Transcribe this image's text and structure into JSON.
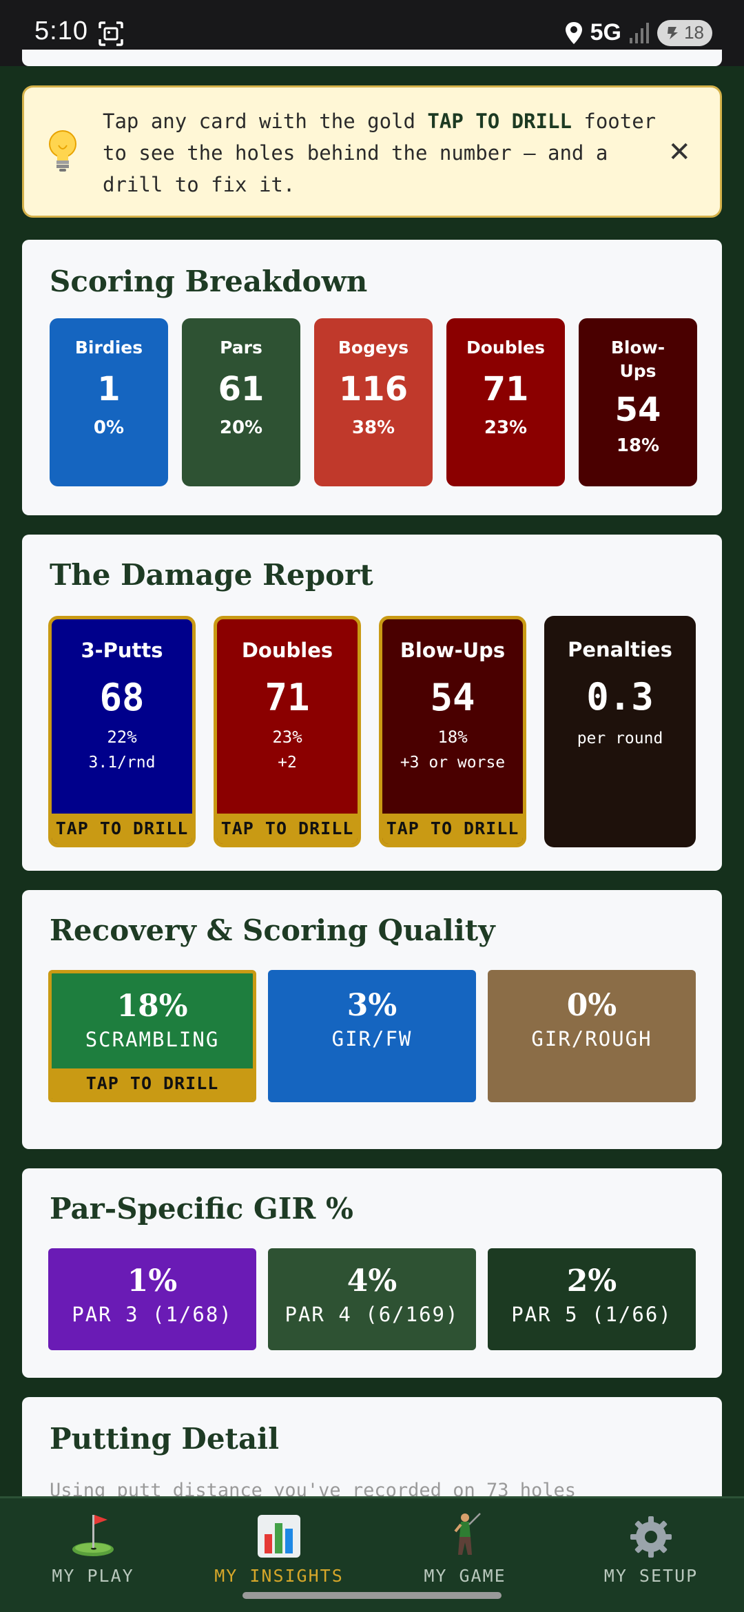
{
  "status_bar": {
    "time": "5:10",
    "network": "5G",
    "battery": "18"
  },
  "tip": {
    "text_before": "Tap any card with the gold ",
    "highlight": "TAP TO DRILL",
    "text_after": " footer to see the holes behind the number — and a drill to fix it.",
    "close": "✕"
  },
  "scoring": {
    "title": "Scoring Breakdown",
    "tiles": [
      {
        "label": "Birdies",
        "value": "1",
        "pct": "0%",
        "color": "#1565c0"
      },
      {
        "label": "Pars",
        "value": "61",
        "pct": "20%",
        "color": "#2e5233"
      },
      {
        "label": "Bogeys",
        "value": "116",
        "pct": "38%",
        "color": "#c0392b"
      },
      {
        "label": "Doubles",
        "value": "71",
        "pct": "23%",
        "color": "#8b0000"
      },
      {
        "label": "Blow-Ups",
        "value": "54",
        "pct": "18%",
        "color": "#4a0000"
      }
    ]
  },
  "damage": {
    "title": "The Damage Report",
    "drill_label": "TAP TO DRILL",
    "tiles": [
      {
        "label": "3-Putts",
        "value": "68",
        "pct": "22%",
        "sub": "3.1/rnd",
        "color": "#00008b"
      },
      {
        "label": "Doubles",
        "value": "71",
        "pct": "23%",
        "sub": "+2",
        "color": "#8b0000"
      },
      {
        "label": "Blow-Ups",
        "value": "54",
        "pct": "18%",
        "sub": "+3 or worse",
        "color": "#4a0000"
      },
      {
        "label": "Penalties",
        "value": "0.3",
        "sub": "per round",
        "color": "#1e110b"
      }
    ]
  },
  "recovery": {
    "title": "Recovery & Scoring Quality",
    "drill_label": "TAP TO DRILL",
    "tiles": [
      {
        "value": "18%",
        "label": "SCRAMBLING",
        "color": "#1e7e3e"
      },
      {
        "value": "3%",
        "label": "GIR/FW",
        "color": "#1565c0"
      },
      {
        "value": "0%",
        "label": "GIR/ROUGH",
        "color": "#8b6d47"
      }
    ]
  },
  "par_gir": {
    "title": "Par-Specific GIR %",
    "tiles": [
      {
        "value": "1%",
        "label": "PAR 3 (1/68)",
        "color": "#6a1bb5"
      },
      {
        "value": "4%",
        "label": "PAR 4 (6/169)",
        "color": "#2e5233"
      },
      {
        "value": "2%",
        "label": "PAR 5 (1/66)",
        "color": "#1c3a22"
      }
    ]
  },
  "putting": {
    "title": "Putting Detail",
    "subtitle": "Using putt distance you've recorded on 73 holes"
  },
  "nav": {
    "items": [
      {
        "label": "MY PLAY"
      },
      {
        "label": "MY INSIGHTS"
      },
      {
        "label": "MY GAME"
      },
      {
        "label": "MY SETUP"
      }
    ]
  }
}
